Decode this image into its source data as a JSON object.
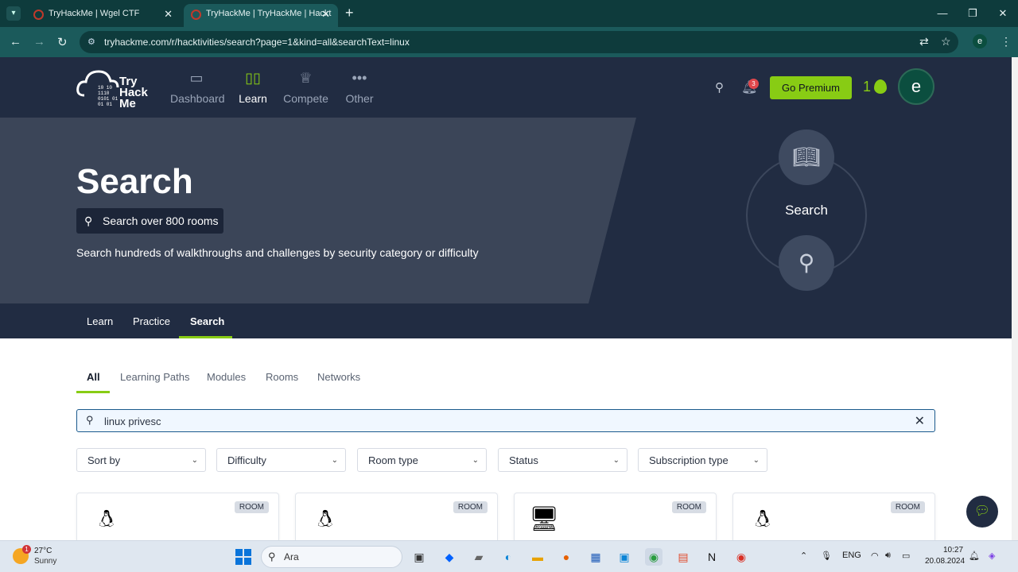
{
  "browser": {
    "tabs": [
      {
        "title": "TryHackMe | Wgel CTF",
        "close": "✕"
      },
      {
        "title": "TryHackMe | TryHackMe | Hackt",
        "close": "✕"
      }
    ],
    "new_tab": "+",
    "url": "tryhackme.com/r/hacktivities/search?page=1&kind=all&searchText=linux",
    "profile_initial": "e"
  },
  "header": {
    "logo_text": [
      "Try",
      "Hack",
      "Me"
    ],
    "nav": [
      {
        "label": "Dashboard",
        "icon": "dashboard-icon",
        "active": false
      },
      {
        "label": "Learn",
        "icon": "book-icon",
        "active": true
      },
      {
        "label": "Compete",
        "icon": "trophy-icon",
        "active": false
      },
      {
        "label": "Other",
        "icon": "more-icon",
        "active": false
      }
    ],
    "notification_count": "3",
    "premium_label": "Go Premium",
    "streak": "1",
    "avatar_initial": "e"
  },
  "hero": {
    "title": "Search",
    "pill": "Search over 800 rooms",
    "subtitle": "Search hundreds of walkthroughs and challenges by security category or difficulty",
    "ring_label": "Search"
  },
  "subnav": {
    "tabs": [
      {
        "label": "Learn",
        "active": false
      },
      {
        "label": "Practice",
        "active": false
      },
      {
        "label": "Search",
        "active": true
      }
    ]
  },
  "filters": {
    "tabs": [
      {
        "label": "All",
        "active": true
      },
      {
        "label": "Learning Paths",
        "active": false
      },
      {
        "label": "Modules",
        "active": false
      },
      {
        "label": "Rooms",
        "active": false
      },
      {
        "label": "Networks",
        "active": false
      }
    ],
    "search_value": "linux privesc",
    "dropdowns": [
      "Sort by",
      "Difficulty",
      "Room type",
      "Status",
      "Subscription type"
    ]
  },
  "cards": [
    {
      "badge": "ROOM",
      "thumb": "penguin-icon"
    },
    {
      "badge": "ROOM",
      "thumb": "penguin-icon"
    },
    {
      "badge": "ROOM",
      "thumb": "monitor-icon"
    },
    {
      "badge": "ROOM",
      "thumb": "penguin-icon"
    }
  ],
  "taskbar": {
    "weather_temp": "27°C",
    "weather_desc": "Sunny",
    "weather_badge": "1",
    "search_placeholder": "Ara",
    "lang": "ENG",
    "time": "10:27",
    "date": "20.08.2024"
  },
  "colors": {
    "accent": "#88cc14",
    "header_bg": "#212c42",
    "hero_bg": "#3b4558",
    "browser_bg": "#0e3b3c"
  }
}
